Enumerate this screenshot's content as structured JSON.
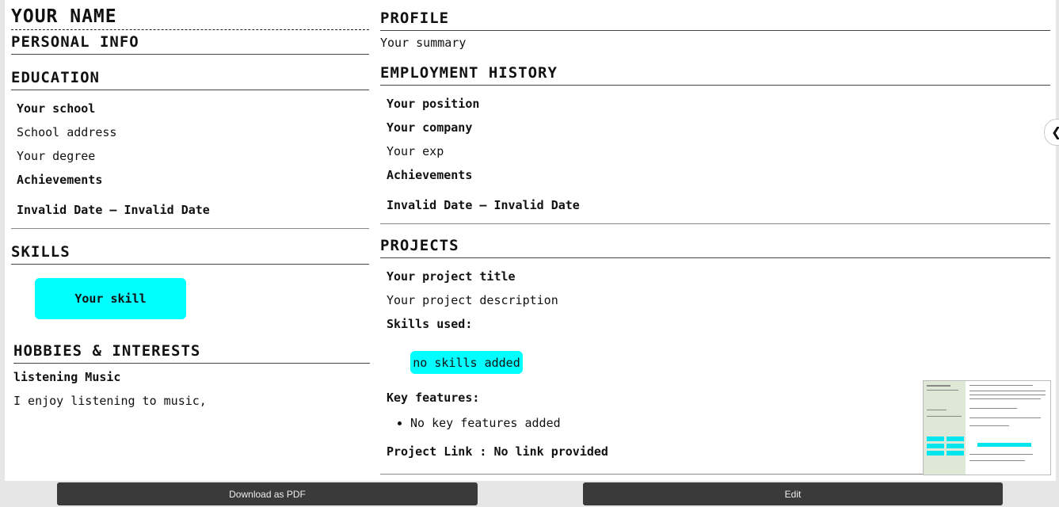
{
  "left": {
    "name": "YOUR NAME",
    "personal_info_title": "PERSONAL INFO",
    "education_title": "EDUCATION",
    "school": "Your school",
    "school_address": "School address",
    "degree": "Your degree",
    "edu_achievements": "Achievements",
    "edu_dates": "Invalid Date – Invalid Date",
    "skills_title": "SKILLS",
    "skill": "Your skill",
    "hobbies_title": "HOBBIES & INTERESTS",
    "hobby_name": "listening Music",
    "hobby_desc": "I enjoy listening to music,"
  },
  "right": {
    "profile_title": "PROFILE",
    "summary": "Your summary",
    "employment_title": "EMPLOYMENT HISTORY",
    "position": "Your position",
    "company": "Your company",
    "experience": "Your exp",
    "emp_achievements": "Achievements",
    "emp_dates": "Invalid Date – Invalid Date",
    "projects_title": "PROJECTS",
    "project_title": "Your project title",
    "project_desc": "Your project description",
    "skills_used_label": "Skills used:",
    "skills_used_value": "no skills added",
    "key_features_label": "Key features:",
    "key_feature": "No key features added",
    "project_link": "Project Link : No link provided"
  },
  "buttons": {
    "download": "Download as PDF",
    "edit": "Edit"
  },
  "colors": {
    "skill_pill": "#00ffff",
    "button_bg": "#3a3a3a"
  },
  "icons": {
    "side_handle": "chevron-left-icon"
  }
}
